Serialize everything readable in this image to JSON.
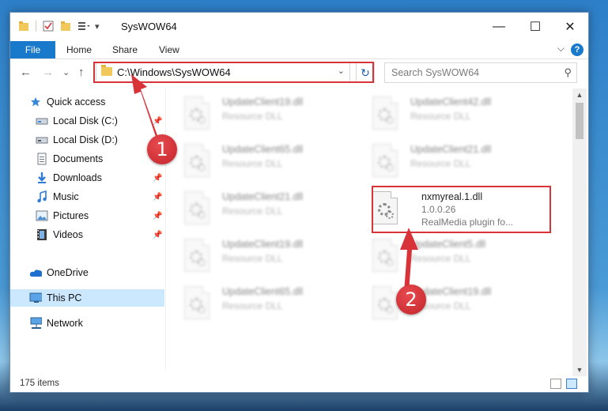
{
  "window": {
    "title": "SysWOW64",
    "buttons": {
      "minimize": "—",
      "maximize": "☐",
      "close": "✕"
    }
  },
  "ribbon": {
    "file_tab": "File",
    "tabs": [
      "Home",
      "Share",
      "View"
    ],
    "help": "?",
    "collapse": "⌵"
  },
  "navbar": {
    "back": "←",
    "forward": "→",
    "recent": "⌄",
    "up": "↑",
    "address": "C:\\Windows\\SysWOW64",
    "address_dropdown": "⌄",
    "refresh": "↻",
    "search_placeholder": "Search SysWOW64",
    "search_icon": "⚲"
  },
  "sidebar": {
    "items": [
      {
        "label": "Quick access",
        "icon": "star-icon",
        "pinned": false
      },
      {
        "label": "Local Disk (C:)",
        "icon": "drive-icon",
        "pinned": true
      },
      {
        "label": "Local Disk (D:)",
        "icon": "drive-icon",
        "pinned": true
      },
      {
        "label": "Documents",
        "icon": "documents-icon",
        "pinned": true
      },
      {
        "label": "Downloads",
        "icon": "downloads-icon",
        "pinned": true
      },
      {
        "label": "Music",
        "icon": "music-icon",
        "pinned": true
      },
      {
        "label": "Pictures",
        "icon": "pictures-icon",
        "pinned": true
      },
      {
        "label": "Videos",
        "icon": "videos-icon",
        "pinned": true
      },
      {
        "label": "OneDrive",
        "icon": "onedrive-icon",
        "pinned": false
      },
      {
        "label": "This PC",
        "icon": "pc-icon",
        "pinned": false,
        "selected": true
      },
      {
        "label": "Network",
        "icon": "network-icon",
        "pinned": false
      }
    ]
  },
  "files": [
    {
      "name": "UpdateClient19.dll",
      "sub": "Resource DLL"
    },
    {
      "name": "UpdateClient42.dll",
      "sub": "Resource DLL"
    },
    {
      "name": "UpdateClient65.dll",
      "sub": "Resource DLL"
    },
    {
      "name": "UpdateClient21.dll",
      "sub": "Resource DLL"
    },
    {
      "name": "UpdateClient21.dll",
      "sub": "Resource DLL"
    },
    {
      "name": "nxmyreal.1.dll",
      "version": "1.0.0.26",
      "description": "RealMedia plugin fo...",
      "highlighted": true
    },
    {
      "name": "UpdateClient19.dll",
      "sub": "Resource DLL"
    },
    {
      "name": "UpdateClient5.dll",
      "sub": "Resource DLL"
    },
    {
      "name": "UpdateClient65.dll",
      "sub": "Resource DLL"
    },
    {
      "name": "UpdateClient19.dll",
      "sub": "Resource DLL"
    }
  ],
  "status": {
    "item_count": "175 items"
  },
  "annotations": {
    "step1": "1",
    "step2": "2",
    "color": "#d9333a"
  },
  "colors": {
    "accent": "#1979ca",
    "selection": "#cce8ff"
  }
}
